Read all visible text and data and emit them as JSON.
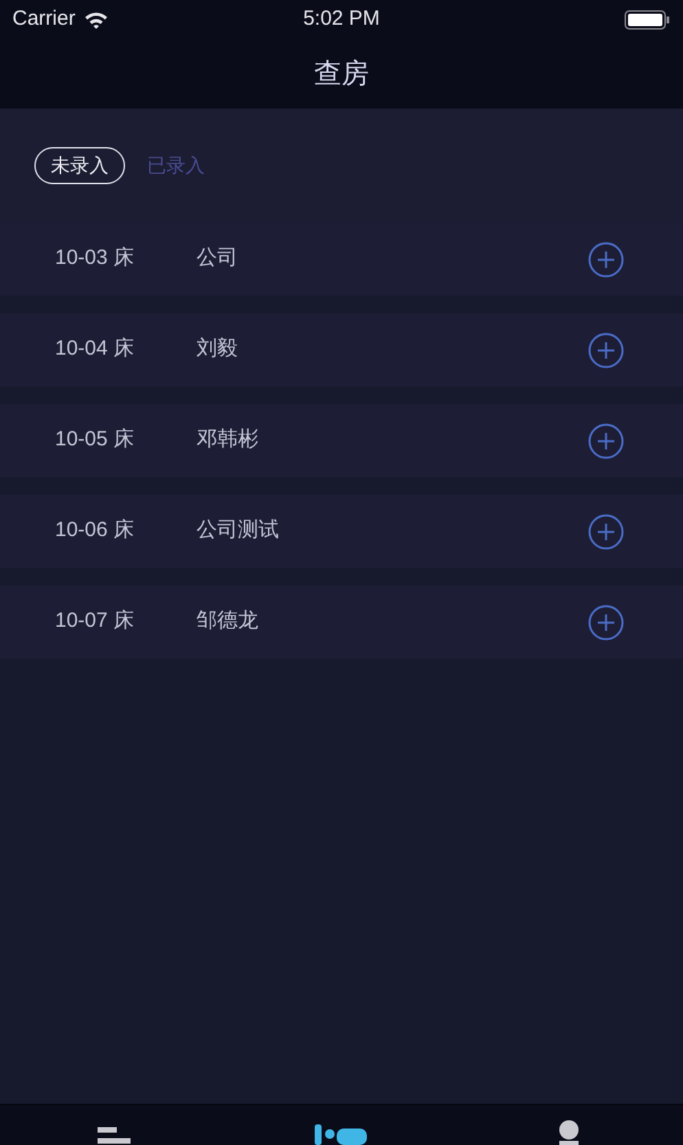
{
  "status_bar": {
    "carrier": "Carrier",
    "time": "5:02 PM"
  },
  "nav": {
    "title": "查房"
  },
  "filters": [
    {
      "label": "未录入",
      "selected": true
    },
    {
      "label": "已录入",
      "selected": false
    }
  ],
  "rows": [
    {
      "bed": "10-03 床",
      "name": "公司"
    },
    {
      "bed": "10-04 床",
      "name": "刘毅"
    },
    {
      "bed": "10-05 床",
      "name": "邓韩彬"
    },
    {
      "bed": "10-06 床",
      "name": "公司测试"
    },
    {
      "bed": "10-07 床",
      "name": "邹德龙"
    }
  ],
  "tab_bar": [
    {
      "kind": "list",
      "selected": false
    },
    {
      "kind": "bed",
      "selected": true
    },
    {
      "kind": "person",
      "selected": false
    }
  ]
}
